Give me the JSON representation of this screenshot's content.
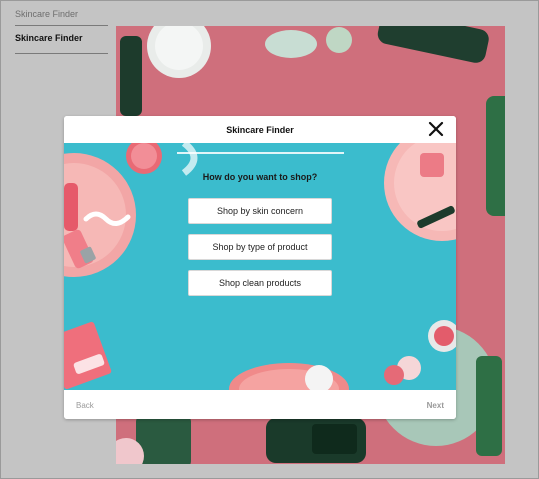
{
  "nav": {
    "breadcrumb": "Skincare Finder",
    "current": "Skincare Finder"
  },
  "modal": {
    "title": "Skincare Finder",
    "question": "How do you want to shop?",
    "options": [
      {
        "label": "Shop by skin concern"
      },
      {
        "label": "Shop by type of product"
      },
      {
        "label": "Shop clean products"
      }
    ],
    "back_label": "Back",
    "next_label": "Next",
    "progress": 0
  },
  "colors": {
    "page_bg": "#c4c4c4",
    "hero_pink": "#cf6f7c",
    "modal_teal": "#3bbccd",
    "tube_green": "#1f4a34"
  },
  "icons": {
    "close": "close-icon"
  }
}
